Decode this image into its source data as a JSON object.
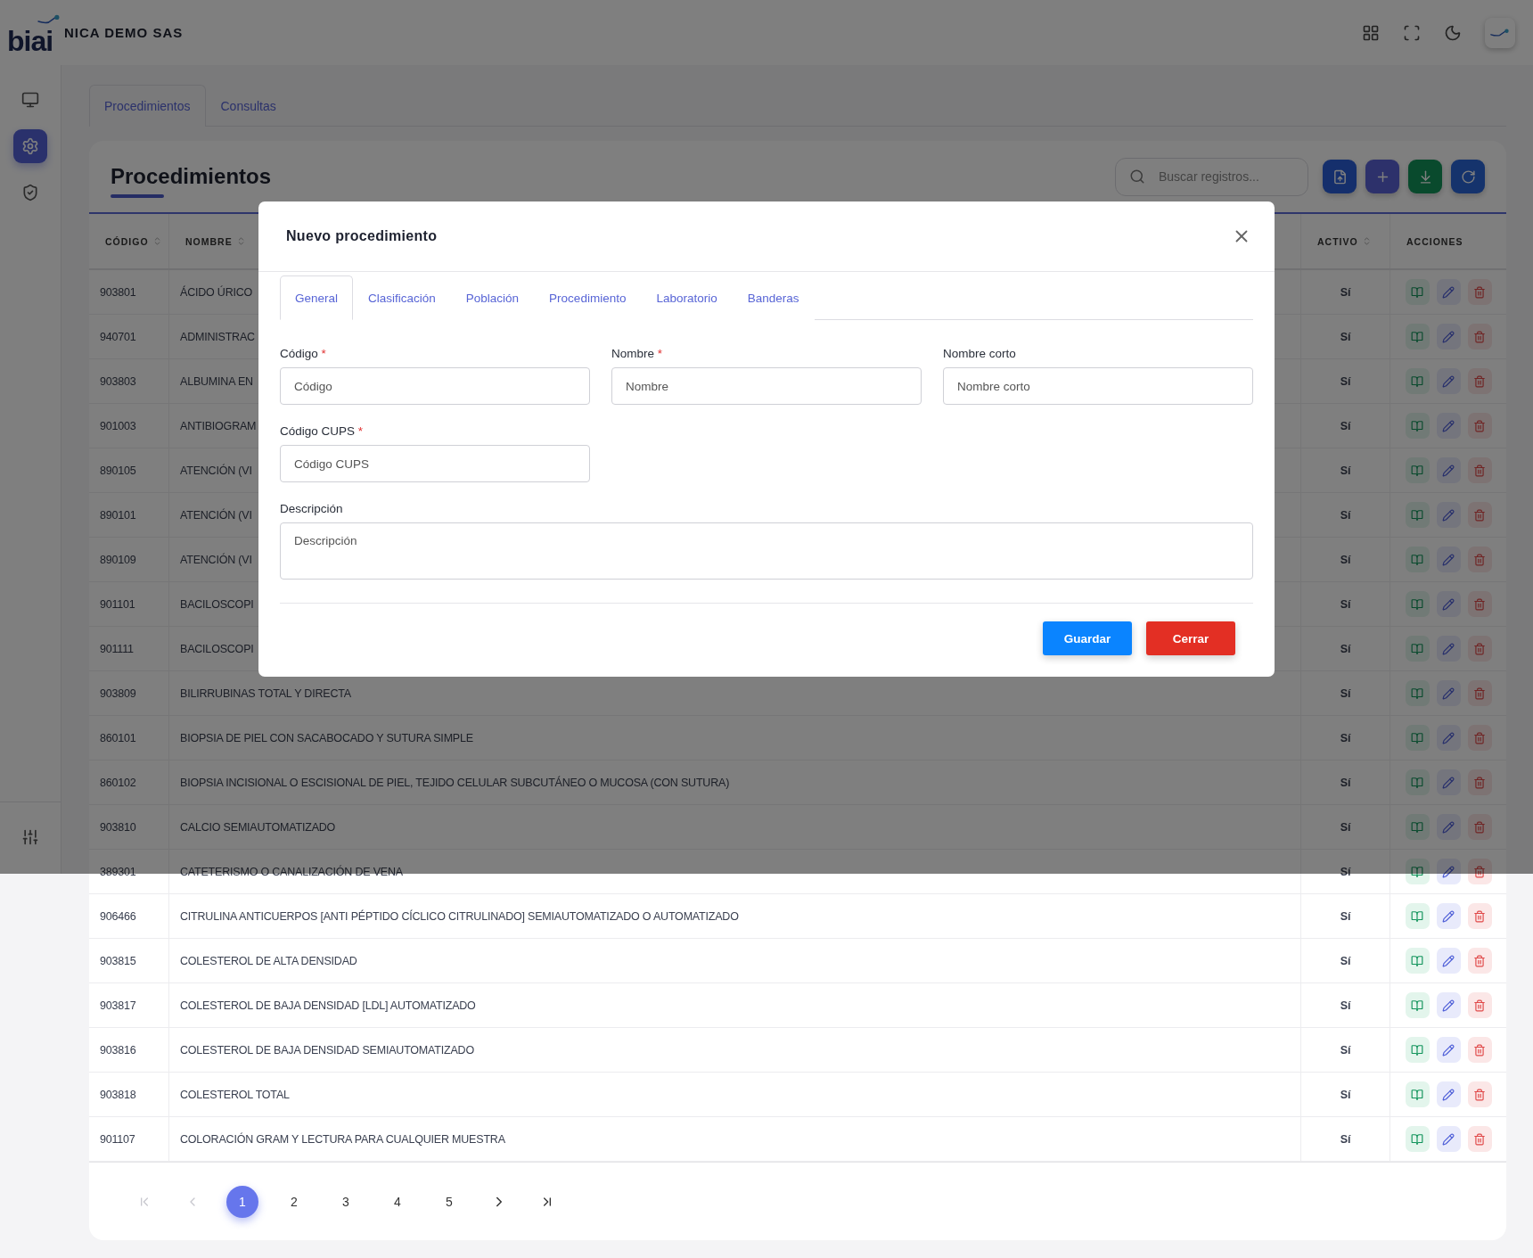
{
  "header": {
    "logo_text": "biai",
    "company": "NICA DEMO SAS",
    "tools": [
      {
        "kind": "apps"
      },
      {
        "kind": "fullscreen"
      },
      {
        "kind": "theme"
      },
      {
        "kind": "avatar"
      }
    ]
  },
  "sidebar": {
    "items": [
      {
        "kind": "monitor",
        "selected": false
      },
      {
        "kind": "settings",
        "selected": true
      },
      {
        "kind": "shield",
        "selected": false
      }
    ],
    "footer_items": [
      {
        "kind": "sliders",
        "selected": false
      }
    ]
  },
  "page_tabs": [
    {
      "label": "Procedimientos",
      "selected": true
    },
    {
      "label": "Consultas",
      "selected": false
    }
  ],
  "card": {
    "title": "Procedimientos",
    "search": {
      "placeholder": "Buscar registros..."
    },
    "toolbar_buttons": [
      {
        "kind": "upload"
      },
      {
        "kind": "add"
      },
      {
        "kind": "download"
      },
      {
        "kind": "refresh"
      }
    ]
  },
  "table": {
    "columns": [
      {
        "label": "CÓDIGO",
        "sortable": true
      },
      {
        "label": "NOMBRE",
        "sortable": true
      },
      {
        "label": "ACTIVO",
        "sortable": true
      },
      {
        "label": "ACCIONES",
        "sortable": false
      }
    ],
    "rows": [
      {
        "code": "903801",
        "name": "ÁCIDO ÚRICO",
        "active": "Sí"
      },
      {
        "code": "940701",
        "name": "ADMINISTRAC",
        "active": "Sí"
      },
      {
        "code": "903803",
        "name": "ALBUMINA EN",
        "active": "Sí"
      },
      {
        "code": "901003",
        "name": "ANTIBIOGRAM",
        "active": "Sí"
      },
      {
        "code": "890105",
        "name": "ATENCIÓN (VI",
        "active": "Sí"
      },
      {
        "code": "890101",
        "name": "ATENCIÓN (VI",
        "active": "Sí"
      },
      {
        "code": "890109",
        "name": "ATENCIÓN (VI",
        "active": "Sí"
      },
      {
        "code": "901101",
        "name": "BACILOSCOPI",
        "active": "Sí"
      },
      {
        "code": "901111",
        "name": "BACILOSCOPI",
        "active": "Sí"
      },
      {
        "code": "903809",
        "name": "BILIRRUBINAS TOTAL Y DIRECTA",
        "active": "Sí"
      },
      {
        "code": "860101",
        "name": "BIOPSIA DE PIEL CON SACABOCADO Y SUTURA SIMPLE",
        "active": "Sí"
      },
      {
        "code": "860102",
        "name": "BIOPSIA INCISIONAL O ESCISIONAL DE PIEL, TEJIDO CELULAR SUBCUTÁNEO O MUCOSA (CON SUTURA)",
        "active": "Sí"
      },
      {
        "code": "903810",
        "name": "CALCIO SEMIAUTOMATIZADO",
        "active": "Sí"
      },
      {
        "code": "389301",
        "name": "CATETERISMO O CANALIZACIÓN DE VENA",
        "active": "Sí"
      },
      {
        "code": "906466",
        "name": "CITRULINA ANTICUERPOS [ANTI PÉPTIDO CÍCLICO CITRULINADO] SEMIAUTOMATIZADO O AUTOMATIZADO",
        "active": "Sí"
      },
      {
        "code": "903815",
        "name": "COLESTEROL DE ALTA DENSIDAD",
        "active": "Sí"
      },
      {
        "code": "903817",
        "name": "COLESTEROL DE BAJA DENSIDAD [LDL] AUTOMATIZADO",
        "active": "Sí"
      },
      {
        "code": "903816",
        "name": "COLESTEROL DE BAJA DENSIDAD SEMIAUTOMATIZADO",
        "active": "Sí"
      },
      {
        "code": "903818",
        "name": "COLESTEROL TOTAL",
        "active": "Sí"
      },
      {
        "code": "901107",
        "name": "COLORACIÓN GRAM Y LECTURA PARA CUALQUIER MUESTRA",
        "active": "Sí"
      }
    ]
  },
  "pagination": {
    "first_disabled": true,
    "prev_disabled": true,
    "pages": [
      {
        "label": "1",
        "selected": true
      },
      {
        "label": "2",
        "selected": false
      },
      {
        "label": "3",
        "selected": false
      },
      {
        "label": "4",
        "selected": false
      },
      {
        "label": "5",
        "selected": false
      }
    ],
    "next_disabled": false,
    "last_disabled": false
  },
  "modal": {
    "title": "Nuevo procedimiento",
    "tabs": [
      {
        "label": "General",
        "selected": true
      },
      {
        "label": "Clasificación",
        "selected": false
      },
      {
        "label": "Población",
        "selected": false
      },
      {
        "label": "Procedimiento",
        "selected": false
      },
      {
        "label": "Laboratorio",
        "selected": false
      },
      {
        "label": "Banderas",
        "selected": false
      }
    ],
    "fields": [
      {
        "kind": "input",
        "label": "Código",
        "required_mark": "*",
        "placeholder": "Código"
      },
      {
        "kind": "input",
        "label": "Nombre",
        "required_mark": "*",
        "placeholder": "Nombre"
      },
      {
        "kind": "input",
        "label": "Nombre corto",
        "placeholder": "Nombre corto"
      },
      {
        "kind": "input",
        "label": "Código CUPS",
        "required_mark": "*",
        "placeholder": "Código CUPS"
      },
      {
        "kind": "textarea",
        "label": "Descripción",
        "placeholder": "Descripción"
      }
    ],
    "buttons": [
      {
        "kind": "primary",
        "label": "Guardar"
      },
      {
        "kind": "danger",
        "label": "Cerrar"
      }
    ]
  }
}
